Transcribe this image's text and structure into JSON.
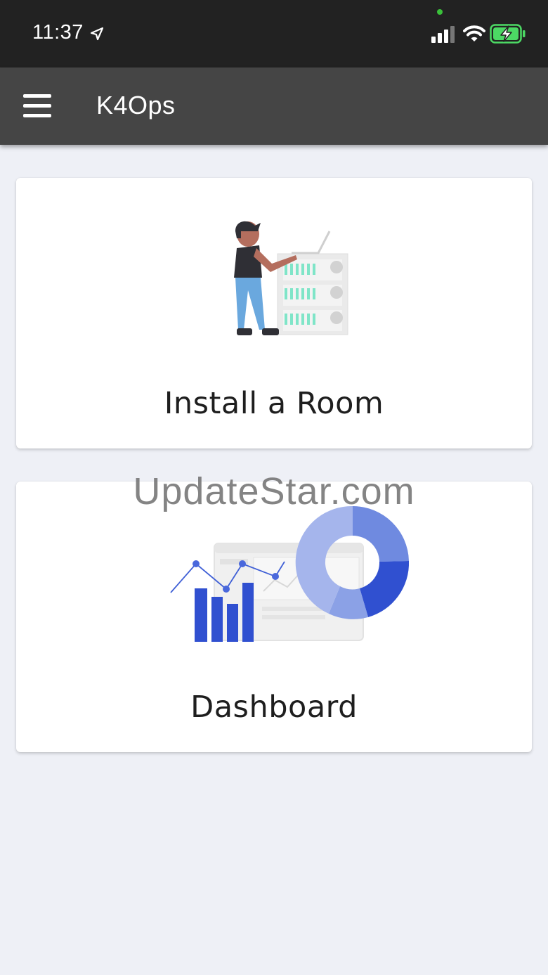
{
  "status_bar": {
    "time": "11:37",
    "icons": [
      "location-arrow-icon",
      "signal-icon",
      "wifi-icon",
      "battery-charging-icon"
    ]
  },
  "app_bar": {
    "title": "K4Ops",
    "menu_icon": "hamburger-menu-icon"
  },
  "cards": {
    "install": {
      "label": "Install a Room",
      "illustration": "person-server-illustration"
    },
    "dashboard": {
      "label": "Dashboard",
      "illustration": "charts-dashboard-illustration"
    }
  },
  "watermark": "UpdateStar.com",
  "colors": {
    "status_bar_bg": "#222222",
    "app_bar_bg": "#454545",
    "page_bg": "#eef0f6",
    "chart_blue": "#3050d0",
    "server_accent": "#7fe5c8",
    "battery_green": "#4cd964"
  }
}
